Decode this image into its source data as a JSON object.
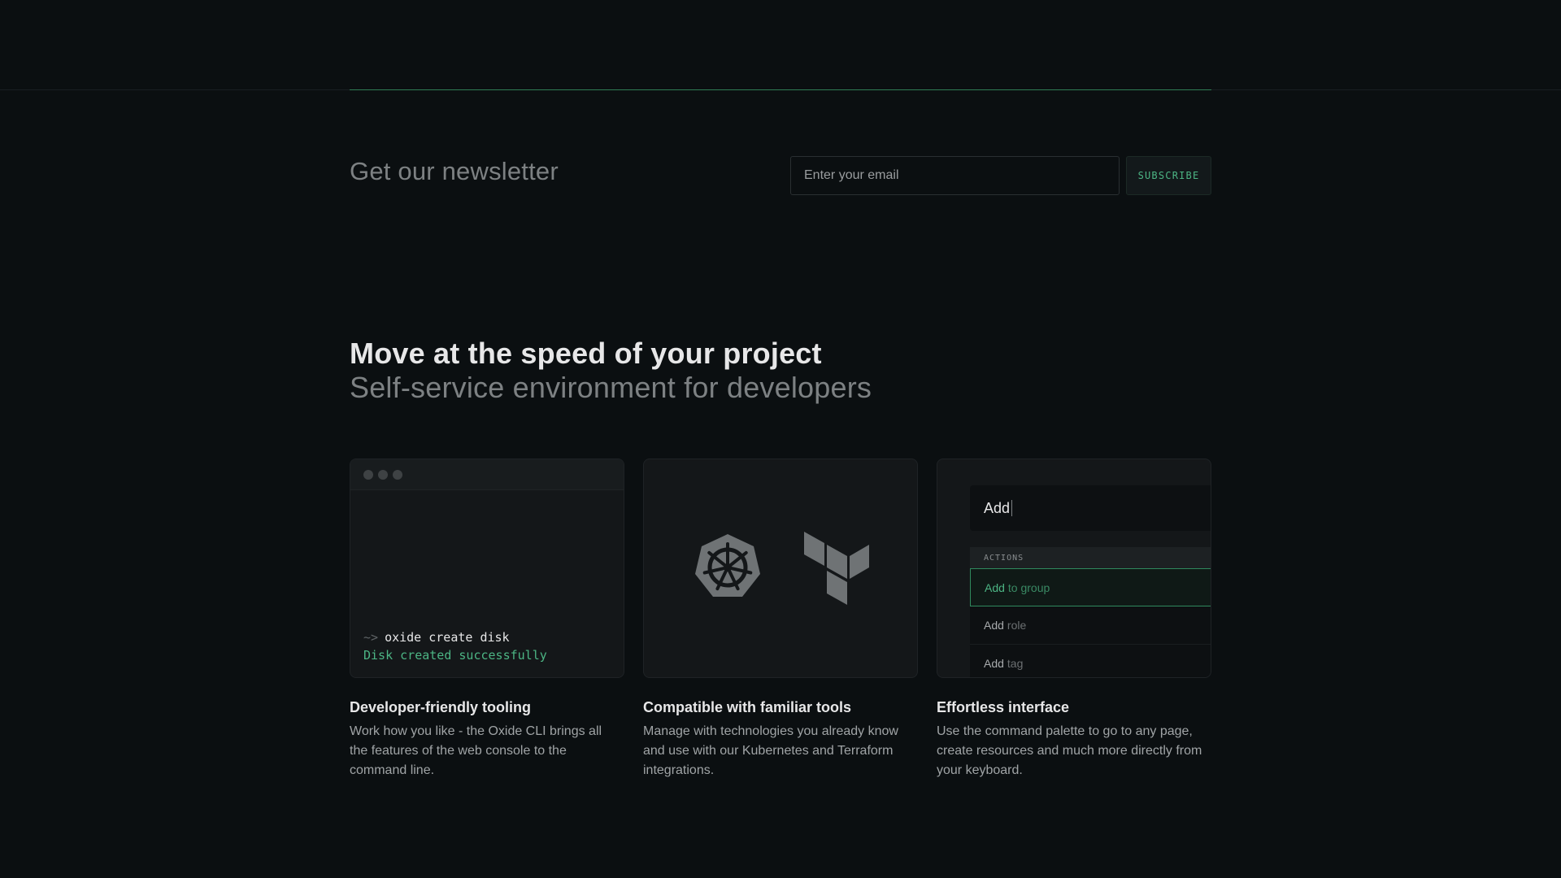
{
  "newsletter": {
    "title": "Get our newsletter",
    "email_placeholder": "Enter your email",
    "subscribe_label": "SUBSCRIBE"
  },
  "section": {
    "title": "Move at the speed of your project",
    "subtitle": "Self-service environment for developers"
  },
  "cards": [
    {
      "title": "Developer-friendly tooling",
      "description": "Work how you like - the Oxide CLI brings all the features of the web console to the command line.",
      "terminal": {
        "prompt": "~>",
        "command": "oxide create disk",
        "output": "Disk created successfully"
      }
    },
    {
      "title": "Compatible with familiar tools",
      "description": "Manage with technologies you already know and use with our Kubernetes and Terraform integrations.",
      "icons": [
        "kubernetes-icon",
        "terraform-icon"
      ]
    },
    {
      "title": "Effortless interface",
      "description": "Use the command palette to go to any page, create resources and much more directly from your keyboard.",
      "palette": {
        "query": "Add",
        "group_label": "ACTIONS",
        "items": [
          {
            "highlight": "Add",
            "rest": "to group",
            "selected": true
          },
          {
            "highlight": "Add",
            "rest": "role",
            "selected": false
          },
          {
            "highlight": "Add",
            "rest": "tag",
            "selected": false
          }
        ]
      }
    }
  ],
  "colors": {
    "background": "#0b0f11",
    "accent": "#4cb584",
    "card": "#141719"
  }
}
